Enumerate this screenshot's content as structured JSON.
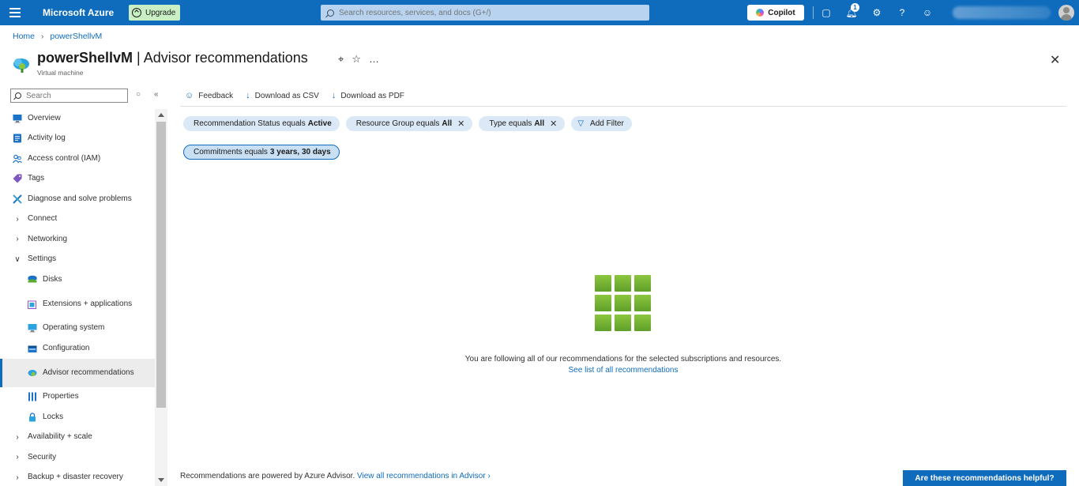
{
  "topbar": {
    "brand": "Microsoft Azure",
    "upgrade_label": "Upgrade",
    "search_placeholder": "Search resources, services, and docs (G+/)",
    "copilot_label": "Copilot",
    "notification_count": "1",
    "accent_color": "#0f6cbd"
  },
  "breadcrumb": {
    "home": "Home",
    "current": "powerShellvM"
  },
  "header": {
    "resource_name": "powerShellvM",
    "separator": " | ",
    "page_name": "Advisor recommendations",
    "subtitle": "Virtual machine"
  },
  "sidebar": {
    "search_placeholder": "Search",
    "items": [
      {
        "label": "Overview",
        "icon": "monitor-icon"
      },
      {
        "label": "Activity log",
        "icon": "activity-log-icon"
      },
      {
        "label": "Access control (IAM)",
        "icon": "people-icon"
      },
      {
        "label": "Tags",
        "icon": "tag-icon"
      },
      {
        "label": "Diagnose and solve problems",
        "icon": "wrench-icon"
      },
      {
        "label": "Connect",
        "icon": "chevron-right-icon"
      },
      {
        "label": "Networking",
        "icon": "chevron-right-icon"
      },
      {
        "label": "Settings",
        "icon": "chevron-down-icon"
      },
      {
        "label": "Disks",
        "icon": "disks-icon"
      },
      {
        "label": "Extensions + applications",
        "icon": "extensions-icon"
      },
      {
        "label": "Operating system",
        "icon": "os-icon"
      },
      {
        "label": "Configuration",
        "icon": "configuration-icon"
      },
      {
        "label": "Advisor recommendations",
        "icon": "advisor-icon"
      },
      {
        "label": "Properties",
        "icon": "properties-icon"
      },
      {
        "label": "Locks",
        "icon": "lock-icon"
      },
      {
        "label": "Availability + scale",
        "icon": "chevron-right-icon"
      },
      {
        "label": "Security",
        "icon": "chevron-right-icon"
      },
      {
        "label": "Backup + disaster recovery",
        "icon": "chevron-right-icon"
      }
    ]
  },
  "toolbar": {
    "feedback": "Feedback",
    "download_csv": "Download as CSV",
    "download_pdf": "Download as PDF"
  },
  "filters": {
    "status_prefix": "Recommendation Status equals",
    "status_value": "Active",
    "rg_prefix": "Resource Group equals",
    "rg_value": "All",
    "type_prefix": "Type equals",
    "type_value": "All",
    "add_filter": "Add Filter",
    "commitments_prefix": "Commitments equals",
    "commitments_value": "3 years, 30 days"
  },
  "empty_state": {
    "message": "You are following all of our recommendations for the selected subscriptions and resources.",
    "link": "See list of all recommendations"
  },
  "footer": {
    "text": "Recommendations are powered by Azure Advisor.",
    "link": "View all recommendations in Advisor",
    "helpful_button": "Are these recommendations helpful?"
  }
}
